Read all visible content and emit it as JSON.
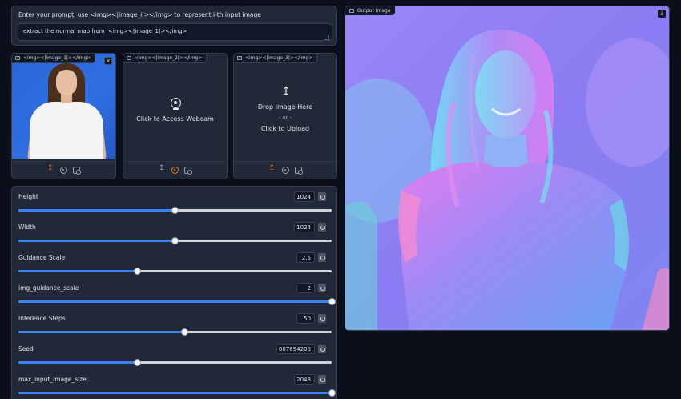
{
  "prompt": {
    "label": "Enter your prompt, use <img><|image_i|></img> to represent i-th input image",
    "value": "extract the normal map from  <img><|image_1|></img>"
  },
  "image_inputs": [
    {
      "tag": "<img><|image_1|></img>",
      "state": "filled"
    },
    {
      "tag": "<img><|image_2|></img>",
      "state": "webcam",
      "message": "Click to Access Webcam"
    },
    {
      "tag": "<img><|image_3|></img>",
      "state": "upload",
      "drop_text": "Drop Image Here",
      "or_text": "- or -",
      "click_text": "Click to Upload"
    }
  ],
  "close_symbol": "×",
  "sliders": [
    {
      "label": "Height",
      "value": "1024",
      "fraction": 0.5
    },
    {
      "label": "Width",
      "value": "1024",
      "fraction": 0.5
    },
    {
      "label": "Guidance Scale",
      "value": "2.5",
      "fraction": 0.38
    },
    {
      "label": "img_guidance_scale",
      "value": "2",
      "fraction": 1.0
    },
    {
      "label": "Inference Steps",
      "value": "50",
      "fraction": 0.53
    },
    {
      "label": "Seed",
      "value": "807654200",
      "fraction": 0.38
    },
    {
      "label": "max_input_image_size",
      "value": "2048",
      "fraction": 1.0
    }
  ],
  "output": {
    "tag": "Output Image",
    "download_symbol": "⤓"
  },
  "colors": {
    "accent": "#3b82f6",
    "upload_accent": "#f97316",
    "panel": "#1f2937",
    "background": "#0b0f19"
  }
}
